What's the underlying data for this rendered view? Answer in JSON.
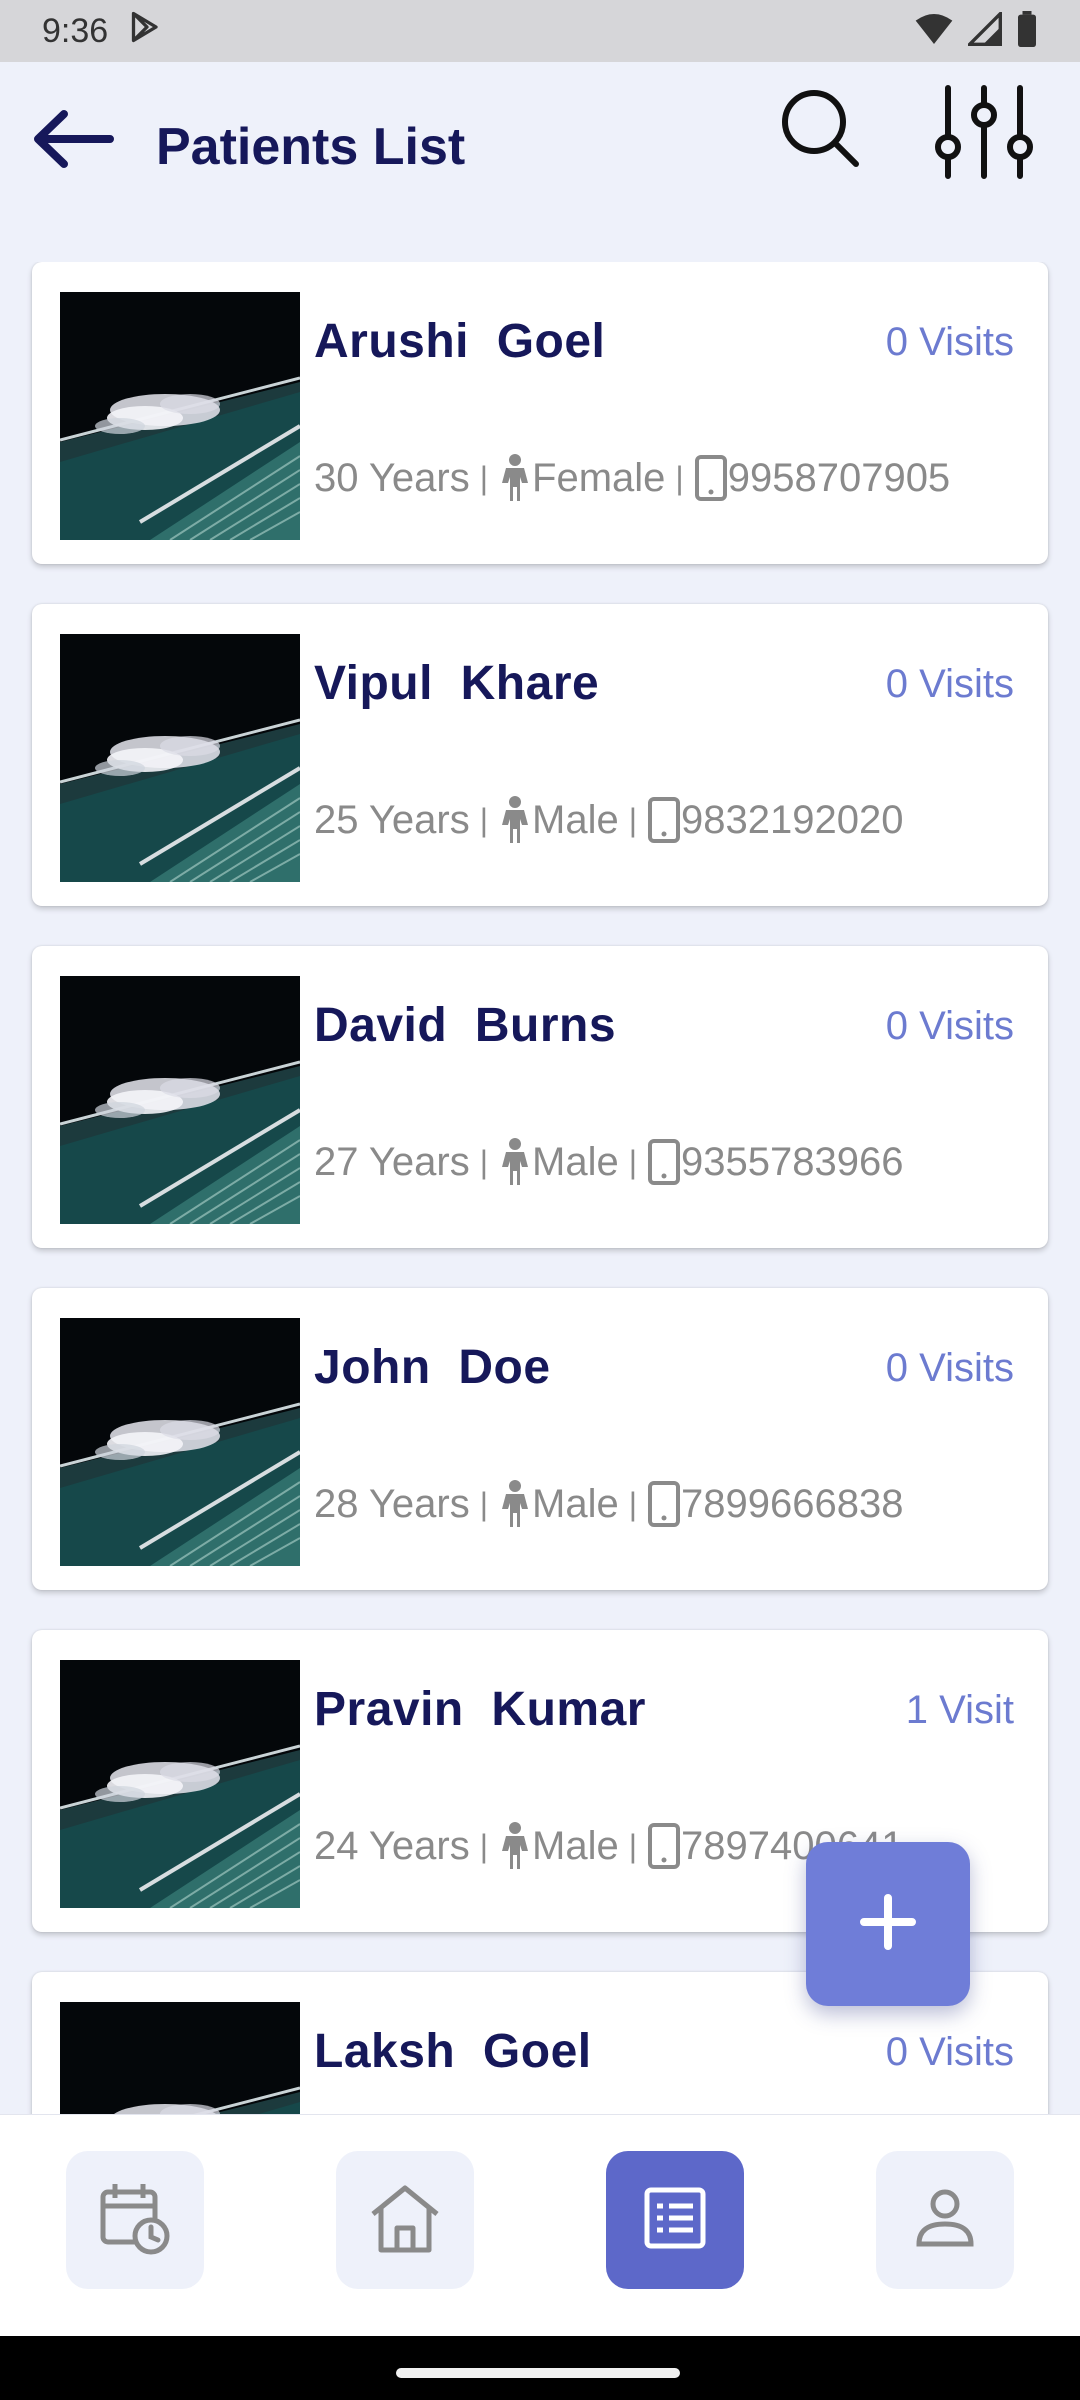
{
  "status_bar": {
    "time": "9:36"
  },
  "header": {
    "title": "Patients List"
  },
  "patients": [
    {
      "first": "Arushi",
      "last": "Goel",
      "visits": "0 Visits",
      "age": "30 Years",
      "gender": "Female",
      "phone": "9958707905"
    },
    {
      "first": "Vipul",
      "last": "Khare",
      "visits": "0 Visits",
      "age": "25 Years",
      "gender": "Male",
      "phone": "9832192020"
    },
    {
      "first": "David",
      "last": "Burns",
      "visits": "0 Visits",
      "age": "27 Years",
      "gender": "Male",
      "phone": "9355783966"
    },
    {
      "first": "John",
      "last": "Doe",
      "visits": "0 Visits",
      "age": "28 Years",
      "gender": "Male",
      "phone": "7899666838"
    },
    {
      "first": "Pravin",
      "last": "Kumar",
      "visits": "1 Visit",
      "age": "24 Years",
      "gender": "Male",
      "phone": "7897400641"
    },
    {
      "first": "Laksh",
      "last": "Goel",
      "visits": "0 Visits",
      "age": "",
      "gender": "",
      "phone": ""
    }
  ],
  "bottom_nav": {
    "items": [
      {
        "icon": "calendar-clock-icon",
        "active": false
      },
      {
        "icon": "home-icon",
        "active": false
      },
      {
        "icon": "list-icon",
        "active": true
      },
      {
        "icon": "person-icon",
        "active": false
      }
    ]
  },
  "colors": {
    "primary": "#16185a",
    "accent": "#6f7dd8",
    "active_nav": "#5d68c9",
    "visits_text": "#6c7bd0",
    "background": "#eef1fa"
  }
}
